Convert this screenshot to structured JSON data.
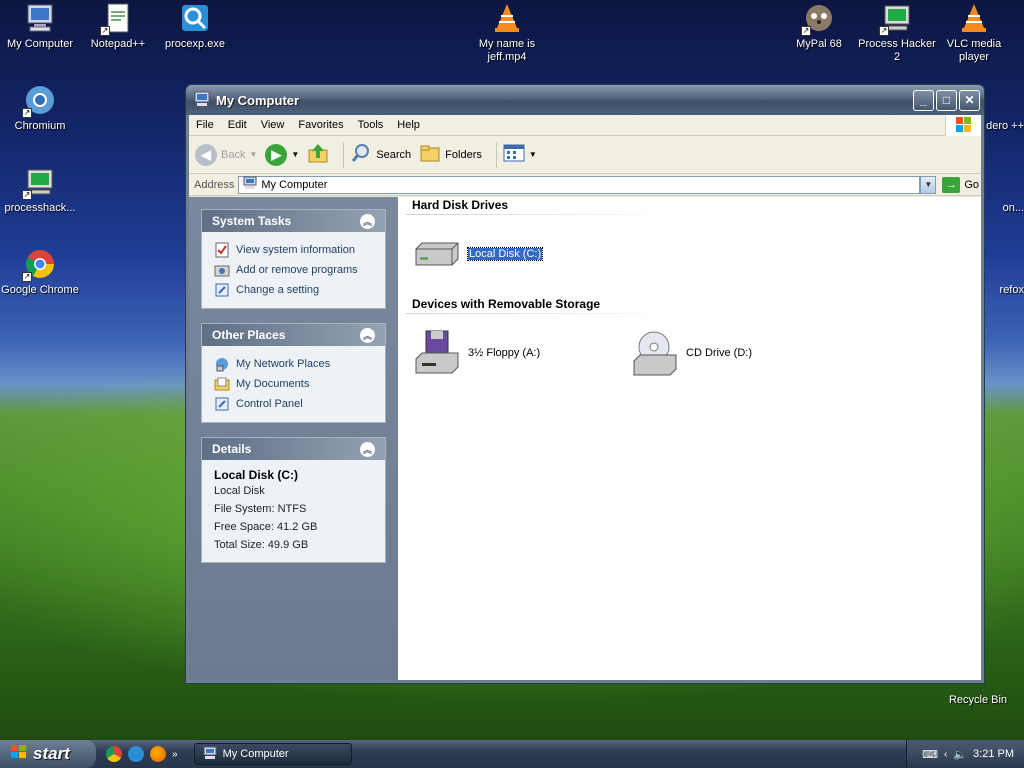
{
  "desktop": {
    "icons": [
      {
        "label": "My Computer"
      },
      {
        "label": "Notepad++"
      },
      {
        "label": "procexp.exe"
      },
      {
        "label": "My name is jeff.mp4"
      },
      {
        "label": "MyPal 68"
      },
      {
        "label": "Process Hacker 2"
      },
      {
        "label": "VLC media player"
      },
      {
        "label": "Chromium"
      },
      {
        "label": "processhack..."
      },
      {
        "label": "Google Chrome"
      },
      {
        "label": "Recycle Bin"
      },
      {
        "label": "dero ++"
      },
      {
        "label": "on..."
      },
      {
        "label": "refox"
      }
    ]
  },
  "window": {
    "title": "My Computer",
    "menu": [
      "File",
      "Edit",
      "View",
      "Favorites",
      "Tools",
      "Help"
    ],
    "toolbar": {
      "back": "Back",
      "search": "Search",
      "folders": "Folders"
    },
    "address": {
      "label": "Address",
      "value": "My Computer",
      "go": "Go"
    },
    "taskpane": {
      "system_tasks": {
        "title": "System Tasks",
        "items": [
          "View system information",
          "Add or remove programs",
          "Change a setting"
        ]
      },
      "other_places": {
        "title": "Other Places",
        "items": [
          "My Network Places",
          "My Documents",
          "Control Panel"
        ]
      },
      "details": {
        "title": "Details",
        "name": "Local Disk (C:)",
        "type": "Local Disk",
        "file_system": "File System: NTFS",
        "free_space": "Free Space: 41.2 GB",
        "total_size": "Total Size: 49.9 GB"
      }
    },
    "groups": {
      "hard_disks": {
        "title": "Hard Disk Drives",
        "items": [
          "Local Disk (C:)"
        ]
      },
      "removable": {
        "title": "Devices with Removable Storage",
        "items": [
          "3½ Floppy (A:)",
          "CD Drive (D:)"
        ]
      }
    }
  },
  "taskbar": {
    "start": "start",
    "task": "My Computer",
    "clock": "3:21 PM"
  }
}
